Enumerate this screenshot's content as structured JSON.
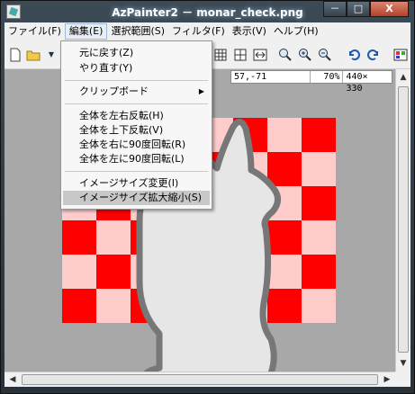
{
  "window": {
    "title": "AzPainter2 － monar_check.png",
    "min_label": "－",
    "max_label": "□",
    "close_label": "X"
  },
  "menubar": {
    "items": [
      {
        "label": "ファイル(F)"
      },
      {
        "label": "編集(E)"
      },
      {
        "label": "選択範囲(S)"
      },
      {
        "label": "フィルタ(F)"
      },
      {
        "label": "表示(V)"
      },
      {
        "label": "ヘルプ(H)"
      }
    ]
  },
  "edit_menu": {
    "items": [
      {
        "label": "元に戻す(Z)"
      },
      {
        "label": "やり直す(Y)"
      },
      {
        "label": "クリップボード"
      },
      {
        "label": "全体を左右反転(H)"
      },
      {
        "label": "全体を上下反転(V)"
      },
      {
        "label": "全体を右に90度回転(R)"
      },
      {
        "label": "全体を左に90度回転(L)"
      },
      {
        "label": "イメージサイズ変更(I)"
      },
      {
        "label": "イメージサイズ拡大縮小(S)"
      }
    ]
  },
  "status": {
    "coords": "57,-71",
    "zoom": "70%",
    "size": "440× 330"
  },
  "colors": {
    "check_red": "#ff0000",
    "check_pink": "#ffcccc",
    "figure_fill": "#e6e6e6",
    "figure_stroke": "#777777",
    "canvas_bg": "#a8a8a8"
  }
}
